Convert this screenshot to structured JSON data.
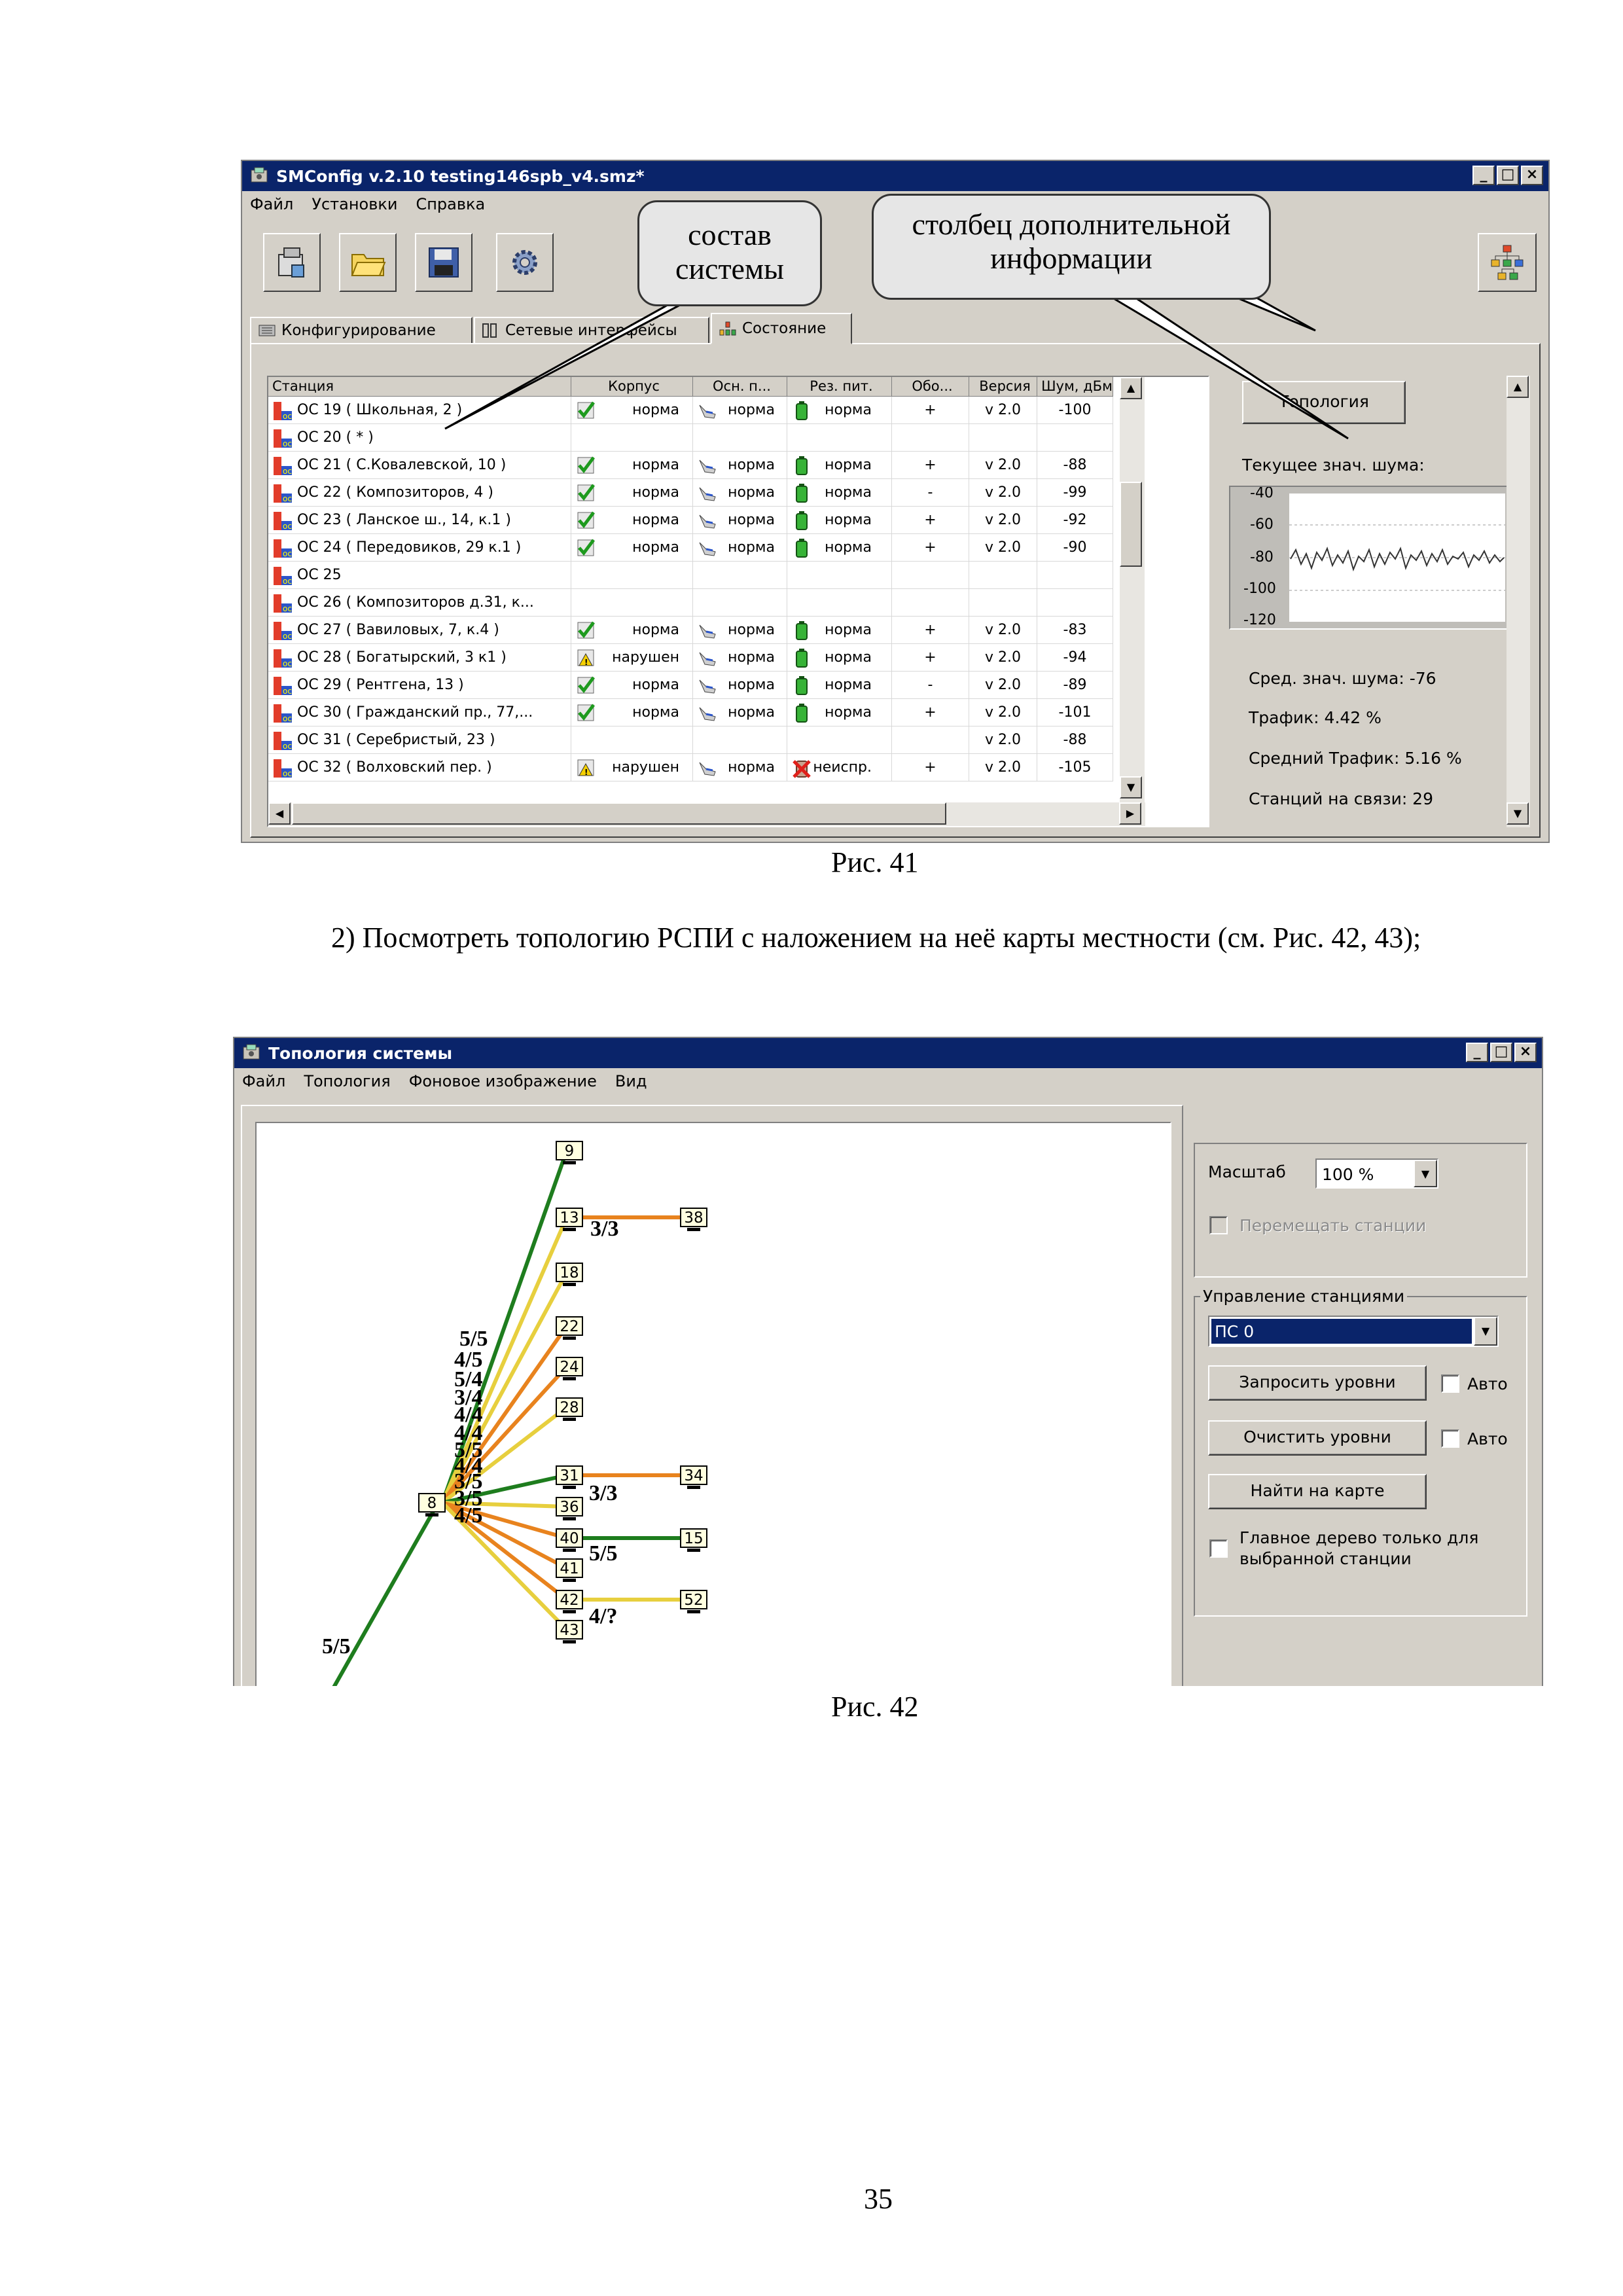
{
  "fig41": {
    "title": "SMConfig v.2.10 testing146spb_v4.smz*",
    "window_buttons": [
      "_",
      "□",
      "×"
    ],
    "menu": [
      "Файл",
      "Установки",
      "Справка"
    ],
    "tabs": [
      "Конфигурирование",
      "Сетевые интерфейсы",
      "Состояние"
    ],
    "columns": [
      "Станция",
      "Корпус",
      "Осн. п...",
      "Рез. пит.",
      "Обо...",
      "Версия",
      "Шум, дБм"
    ],
    "rows": [
      {
        "station": "ОС 19 ( Школьная, 2 )",
        "korpus": "норма",
        "osn": "норма",
        "rez": "норма",
        "obo": "+",
        "ver": "v 2.0",
        "noise": "-100",
        "korpus_icon": "check",
        "rez_icon": "battery-ok"
      },
      {
        "station": "ОС 20 ( * )",
        "korpus": "",
        "osn": "",
        "rez": "",
        "obo": "",
        "ver": "",
        "noise": "",
        "korpus_icon": "",
        "rez_icon": ""
      },
      {
        "station": "ОС 21 ( С.Ковалевской, 10 )",
        "korpus": "норма",
        "osn": "норма",
        "rez": "норма",
        "obo": "+",
        "ver": "v 2.0",
        "noise": "-88",
        "korpus_icon": "check",
        "rez_icon": "battery-ok"
      },
      {
        "station": "ОС 22 ( Композиторов, 4 )",
        "korpus": "норма",
        "osn": "норма",
        "rez": "норма",
        "obo": "-",
        "ver": "v 2.0",
        "noise": "-99",
        "korpus_icon": "check",
        "rez_icon": "battery-ok"
      },
      {
        "station": "ОС 23 ( Ланское ш., 14, к.1 )",
        "korpus": "норма",
        "osn": "норма",
        "rez": "норма",
        "obo": "+",
        "ver": "v 2.0",
        "noise": "-92",
        "korpus_icon": "check",
        "rez_icon": "battery-ok"
      },
      {
        "station": "ОС 24 ( Передовиков, 29 к.1 )",
        "korpus": "норма",
        "osn": "норма",
        "rez": "норма",
        "obo": "+",
        "ver": "v 2.0",
        "noise": "-90",
        "korpus_icon": "check",
        "rez_icon": "battery-ok"
      },
      {
        "station": "ОС 25",
        "korpus": "",
        "osn": "",
        "rez": "",
        "obo": "",
        "ver": "",
        "noise": "",
        "korpus_icon": "",
        "rez_icon": ""
      },
      {
        "station": "ОС 26 ( Композиторов д.31, к...",
        "korpus": "",
        "osn": "",
        "rez": "",
        "obo": "",
        "ver": "",
        "noise": "",
        "korpus_icon": "",
        "rez_icon": ""
      },
      {
        "station": "ОС 27 ( Вавиловых, 7, к.4 )",
        "korpus": "норма",
        "osn": "норма",
        "rez": "норма",
        "obo": "+",
        "ver": "v 2.0",
        "noise": "-83",
        "korpus_icon": "check",
        "rez_icon": "battery-ok"
      },
      {
        "station": "ОС 28 ( Богатырский, 3 к1 )",
        "korpus": "нарушен",
        "osn": "норма",
        "rez": "норма",
        "obo": "+",
        "ver": "v 2.0",
        "noise": "-94",
        "korpus_icon": "warning",
        "rez_icon": "battery-ok"
      },
      {
        "station": "ОС 29 ( Рентгена, 13 )",
        "korpus": "норма",
        "osn": "норма",
        "rez": "норма",
        "obo": "-",
        "ver": "v 2.0",
        "noise": "-89",
        "korpus_icon": "check",
        "rez_icon": "battery-ok"
      },
      {
        "station": "ОС 30 ( Гражданский пр., 77,...",
        "korpus": "норма",
        "osn": "норма",
        "rez": "норма",
        "obo": "+",
        "ver": "v 2.0",
        "noise": "-101",
        "korpus_icon": "check",
        "rez_icon": "battery-ok"
      },
      {
        "station": "ОС 31 ( Серебристый, 23 )",
        "korpus": "",
        "osn": "",
        "rez": "",
        "obo": "",
        "ver": "v 2.0",
        "noise": "-88",
        "korpus_icon": "",
        "rez_icon": ""
      },
      {
        "station": "ОС 32 ( Волховский пер. )",
        "korpus": "нарушен",
        "osn": "норма",
        "rez": "неиспр.",
        "obo": "+",
        "ver": "v 2.0",
        "noise": "-105",
        "korpus_icon": "warning",
        "rez_icon": "battery-fault"
      }
    ],
    "topology_button": "Топология",
    "current_noise_label": "Текущее знач. шума:",
    "noise_axis_ticks": [
      "-40",
      "-60",
      "-80",
      "-100",
      "-120"
    ],
    "avg_noise": "Сред. знач. шума: -76",
    "traffic": "Трафик: 4.42 %",
    "avg_traffic": "Средний Трафик: 5.16 %",
    "stations_online": "Станций на связи: 29",
    "callout_left": "состав системы",
    "callout_right": "столбец дополнительной информации",
    "caption": "Рис. 41"
  },
  "paragraph": "2) Посмотреть топологию РСПИ с наложением на неё карты местности (см. Рис. 42, 43);",
  "fig42": {
    "title": "Топология системы",
    "window_buttons": [
      "_",
      "□",
      "×"
    ],
    "menu": [
      "Файл",
      "Топология",
      "Фоновое изображение",
      "Вид"
    ],
    "scale_label": "Масштаб",
    "scale_value": "100 %",
    "move_stations": "Перемещать станции",
    "group_title": "Управление станциями",
    "station_select": "ПС 0",
    "request_levels": "Запросить уровни",
    "clear_levels": "Очистить уровни",
    "auto1": "Авто",
    "auto2": "Авто",
    "find_on_map": "Найти на карте",
    "main_tree": "Главное дерево только для выбранной станции",
    "nodes": [
      "9",
      "13",
      "38",
      "18",
      "22",
      "24",
      "28",
      "31",
      "34",
      "8",
      "36",
      "40",
      "15",
      "41",
      "42",
      "52",
      "43"
    ],
    "link_labels": [
      "3/3",
      "5/5",
      "4/5",
      "5/4",
      "3/4",
      "4/4",
      "4/4",
      "3/3",
      "5/5",
      "4/4",
      "3/5",
      "3/5",
      "4/5",
      "5/5",
      "4/?",
      "5/5"
    ],
    "caption": "Рис. 42"
  },
  "page_number": "35",
  "colors": {
    "green": "#1e7d1e",
    "yellow": "#e7cf3e",
    "orange": "#e8831e",
    "title_bar": "#0a246a",
    "face": "#d4d0c8"
  }
}
